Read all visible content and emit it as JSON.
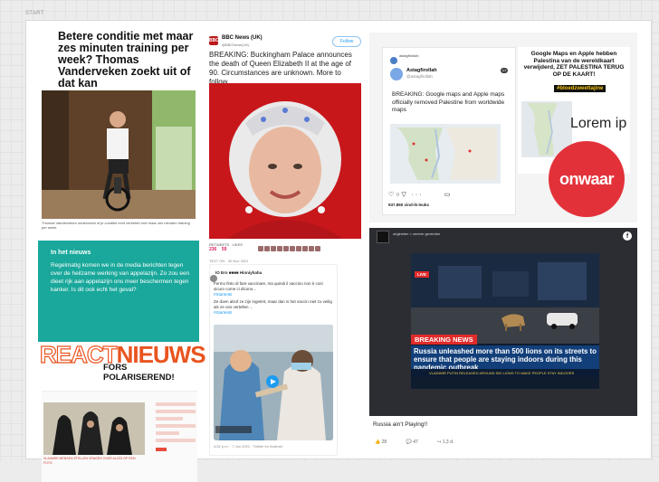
{
  "canvas": {
    "start_label": "START"
  },
  "article1": {
    "headline": "Betere conditie met maar zes minuten training per week? Thomas Vanderveken zoekt uit of dat kan",
    "meta": "09-06-2021 13:03 · Redactie",
    "caption": "Thomas Vanderveken onderzoekt of je conditie echt verbetert met maar zes minuten training per week."
  },
  "news_box": {
    "title": "In het nieuws",
    "text": "Regelmatig komen we in de media berichten tegen over de heilzame werking van appelazijn. Zo zou een dieet rijk aan appelazijn ons meer beschermen tegen kanker. Is dit ook echt het geval?"
  },
  "react": {
    "brand_react": "REACT",
    "brand_nieuws": "NIEUWS",
    "tagline": "FORS POLARISEREND!"
  },
  "bottom_article": {
    "caption": "VLAAMSE MENSEN STELLEN VRAGEN OVER ALLES OP EEN FOTO"
  },
  "bbc_tweet": {
    "logo": "BBC",
    "account": "BBC News (UK)",
    "handle": "@BBCNews(UK)",
    "follow": "Follow",
    "text": "BREAKING: Buckingham Palace announces the death of Queen Elizabeth II at the age of 90. Circumstances are unknown. More to follow.",
    "retweets_label": "RETWEETS",
    "likes_label": "LIKES",
    "retweets": "236",
    "likes": "59"
  },
  "vaccine_tweet": {
    "header": "TEXT ON · 30 Nov 2021",
    "user": "IO Ero ■■■■ Hinniyhaha",
    "text_it": "Fermo finto di fare vaccinare, ma quindi il vaccino non è così sicuro come ci dicono...",
    "hashtag1": "#StartenB",
    "text_nl": "Ze doen alsof ze zijn ingeënt, maar dan is het vaccin niet zo veilig als ze ons vertellen ...",
    "hashtag2": "#StartenB",
    "footer": "4:52 p.m. · 7 Jun 2021 · Twitter for Android"
  },
  "ig_post": {
    "account": "astagfirollah",
    "tweet_name": "Astagfirollah",
    "tweet_handle": "@astagfirollah",
    "badge": "LIT",
    "text": "BREAKING: Google maps and Apple maps officially removed Palestine from worldwide maps",
    "likes": "937.860 vind-ik-leuks"
  },
  "gm_post": {
    "title": "Google Maps en Apple hebben Palestina van de wereldkaart verwijderd, ZET PALESTINA TERUG OP DE KAART!",
    "tag": "#bloedzweettajine",
    "lorem": "Lorem ip",
    "stamp": "onwaar"
  },
  "fb_post": {
    "page": "originelen > vererm geverden",
    "live": "LIVE",
    "breaking": "BREAKING NEWS",
    "ticker": "Russia unleashed more than 500 lions on its streets to ensure that people are staying indoors during this pandemic outbreak",
    "ticker2": "VLADIMIR PUTIN RELEASED AROUND 500 LIONS TO MAKE PEOPLE STAY INDOORS",
    "clock": "13:57",
    "caption": "Russia ain't Playing!!",
    "likes": "28",
    "comments": "47",
    "shares": "1,3 d."
  },
  "colors": {
    "teal": "#19a89b",
    "react_orange": "#e9541f",
    "bbc_red": "#bb1919",
    "onwaar_red": "#e3313a",
    "ticker_blue": "#123f7a"
  }
}
